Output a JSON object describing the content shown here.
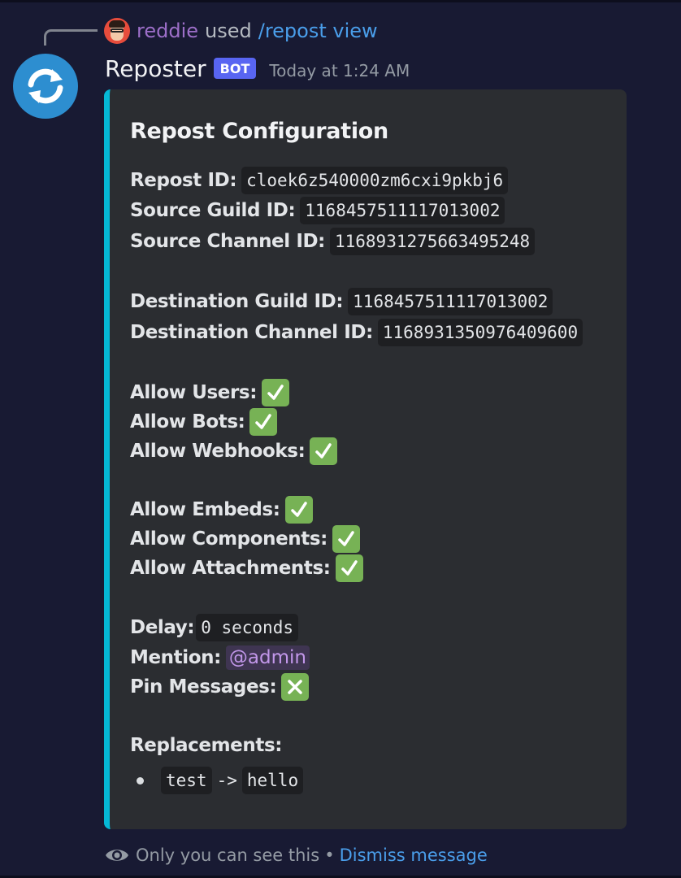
{
  "reply": {
    "username": "reddie",
    "used_text": "used",
    "command": "/repost view"
  },
  "message": {
    "author": "Reposter",
    "tag": "BOT",
    "timestamp": "Today at 1:24 AM"
  },
  "embed": {
    "accent_color": "#05b8d6",
    "title": "Repost Configuration",
    "repost_id_label": "Repost ID:",
    "repost_id": "cloek6z540000zm6cxi9pkbj6",
    "source_guild_label": "Source Guild ID:",
    "source_guild_id": "1168457511117013002",
    "source_channel_label": "Source Channel ID:",
    "source_channel_id": "1168931275663495248",
    "dest_guild_label": "Destination Guild ID:",
    "dest_guild_id": "1168457511117013002",
    "dest_channel_label": "Destination Channel ID:",
    "dest_channel_id": "1168931350976409600",
    "allow_users_label": "Allow Users:",
    "allow_bots_label": "Allow Bots:",
    "allow_webhooks_label": "Allow Webhooks:",
    "allow_embeds_label": "Allow Embeds:",
    "allow_components_label": "Allow Components:",
    "allow_attachments_label": "Allow Attachments:",
    "flags": {
      "allow_users": "check-mark-icon",
      "allow_bots": "check-mark-icon",
      "allow_webhooks": "check-mark-icon",
      "allow_embeds": "check-mark-icon",
      "allow_components": "check-mark-icon",
      "allow_attachments": "check-mark-icon",
      "pin_messages": "cross-mark-icon"
    },
    "delay_label": "Delay:",
    "delay": "0 seconds",
    "mention_label": "Mention:",
    "mention": "@admin",
    "pin_label": "Pin Messages:",
    "replacements_label": "Replacements:",
    "replacements": [
      {
        "from": "test",
        "arrow": "->",
        "to": "hello"
      }
    ]
  },
  "footer": {
    "visibility_text": "Only you can see this",
    "separator": "•",
    "dismiss_label": "Dismiss message"
  }
}
